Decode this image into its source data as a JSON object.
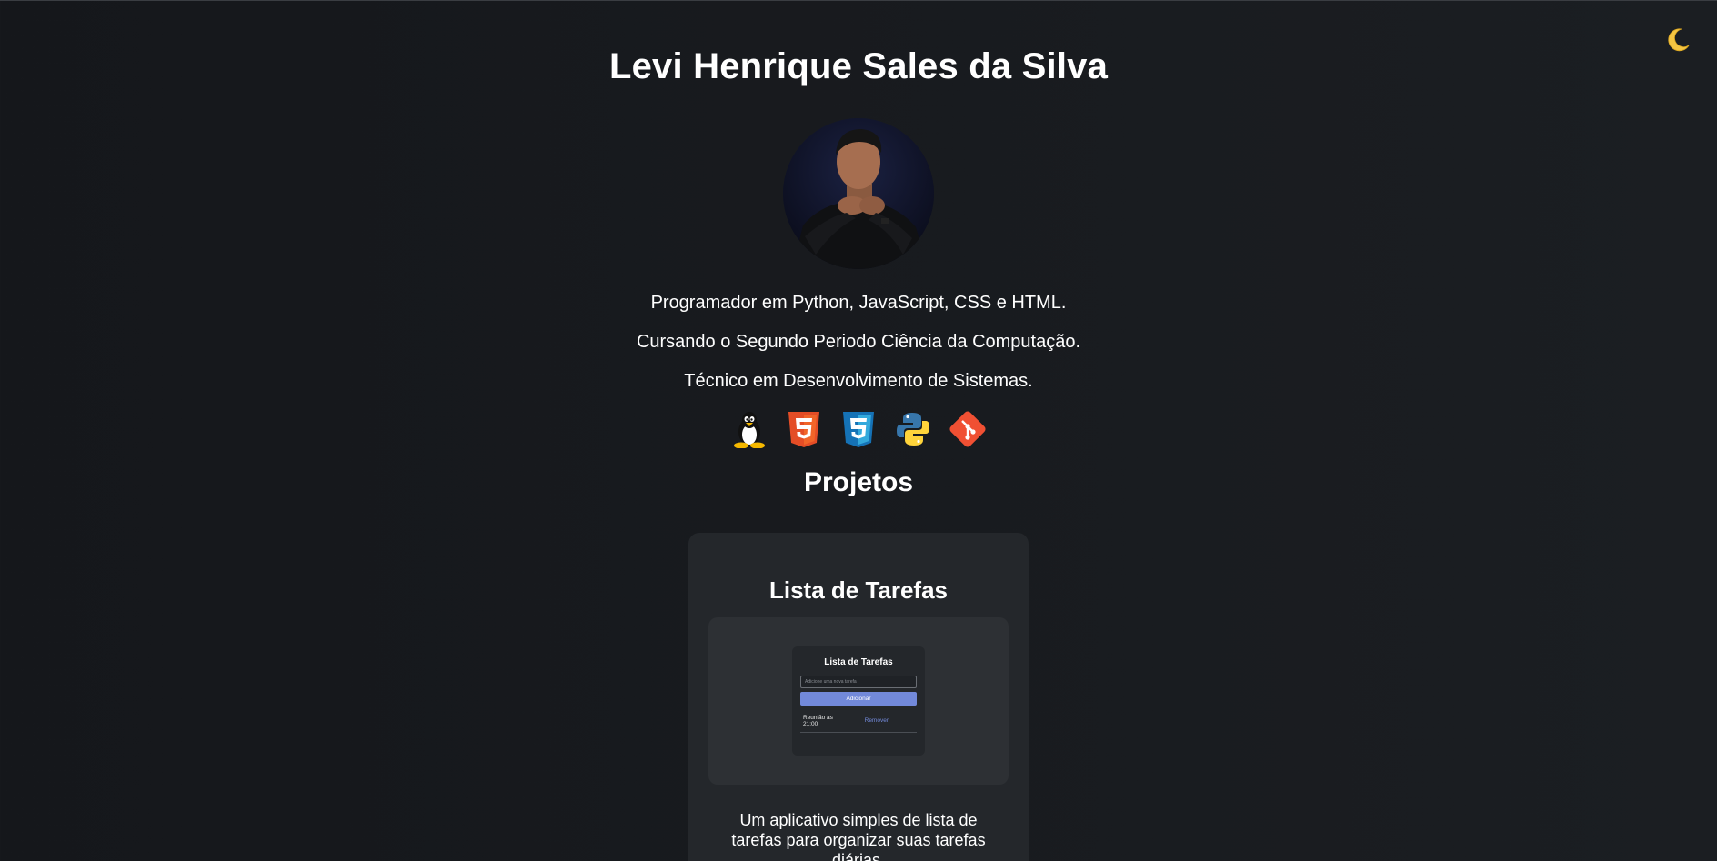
{
  "header": {
    "title": "Levi Henrique Sales da Silva",
    "theme_toggle_icon": "moon-icon"
  },
  "bio": {
    "lines": [
      "Programador em Python, JavaScript, CSS e HTML.",
      "Cursando o Segundo Periodo Ciência da Computação.",
      "Técnico em Desenvolvimento de Sistemas."
    ]
  },
  "tech_icons": [
    "linux-icon",
    "html5-icon",
    "css3-icon",
    "python-icon",
    "git-icon"
  ],
  "projects": {
    "section_title": "Projetos",
    "items": [
      {
        "title": "Lista de Tarefas",
        "preview": {
          "title": "Lista de Tarefas",
          "input_placeholder": "Adicione uma nova tarefa",
          "button_label": "Adicionar",
          "task_text": "Reunião às 21:00",
          "remove_label": "Remover"
        },
        "description": "Um aplicativo simples de lista de tarefas para organizar suas tarefas diárias."
      }
    ]
  },
  "colors": {
    "background": "#15171b",
    "card": "#24272b",
    "accent": "#7289da"
  }
}
